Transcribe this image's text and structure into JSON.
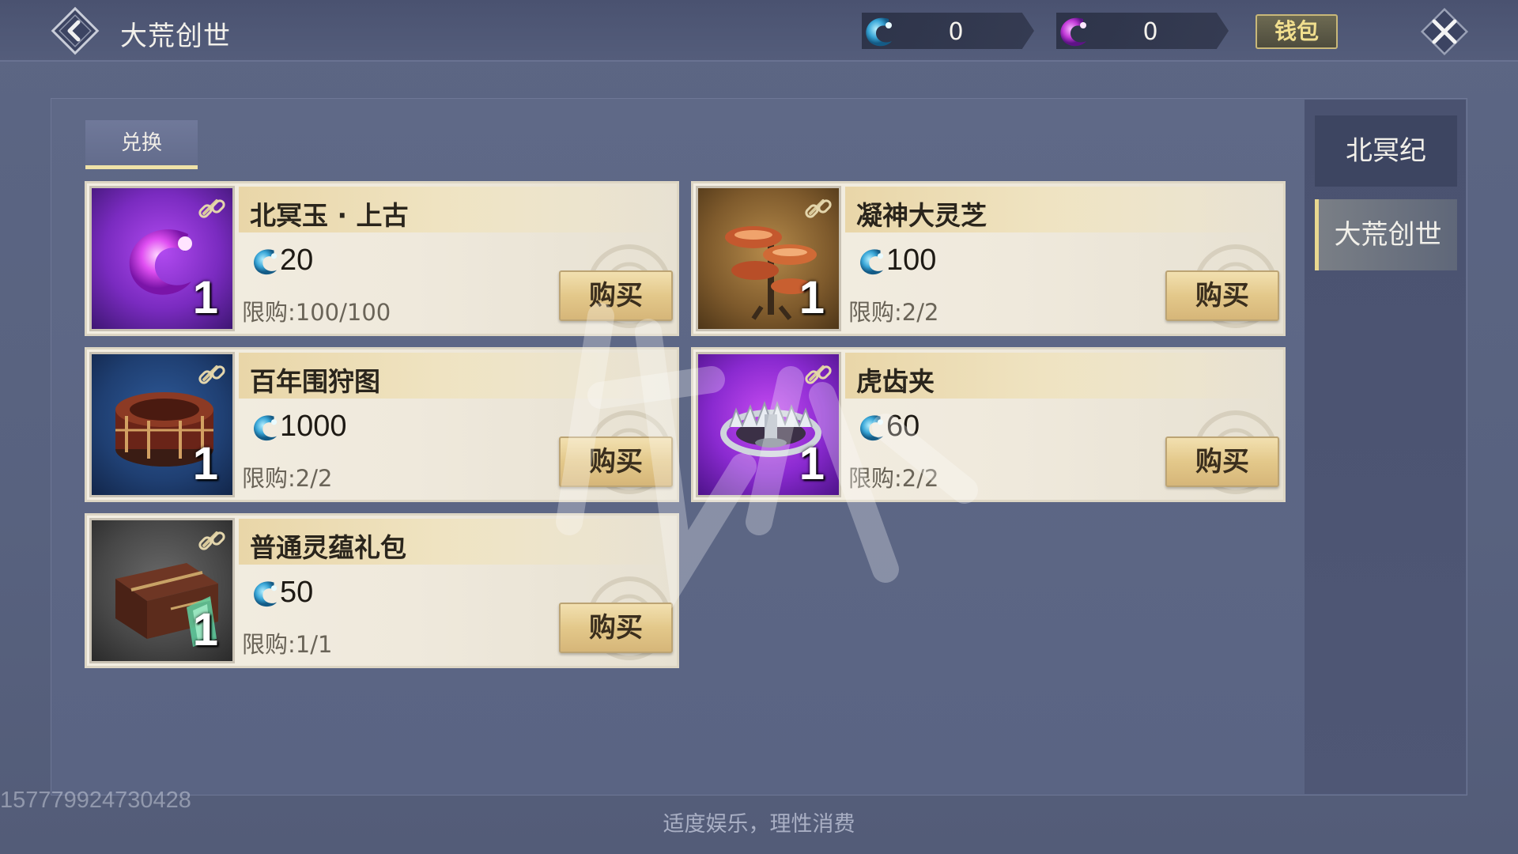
{
  "header": {
    "title": "大荒创世",
    "wallet_label": "钱包",
    "currencies": [
      {
        "icon": "blue-jade-currency-icon",
        "value": "0"
      },
      {
        "icon": "purple-jade-currency-icon",
        "value": "0"
      }
    ]
  },
  "tabs": [
    {
      "label": "兑换"
    }
  ],
  "sidebar": {
    "items": [
      {
        "label": "北冥纪",
        "active": false
      },
      {
        "label": "大荒创世",
        "active": true
      }
    ]
  },
  "items": [
    {
      "name": "北冥玉 · 上古",
      "price": "20",
      "limit": "限购:100/100",
      "qty": "1",
      "buy_label": "购买",
      "icon": "purple-jade-item-icon"
    },
    {
      "name": "凝神大灵芝",
      "price": "100",
      "limit": "限购:2/2",
      "qty": "1",
      "buy_label": "购买",
      "icon": "lingzhi-mushroom-icon"
    },
    {
      "name": "百年围狩图",
      "price": "1000",
      "limit": "限购:2/2",
      "qty": "1",
      "buy_label": "购买",
      "icon": "hunting-scroll-case-icon"
    },
    {
      "name": "虎齿夹",
      "price": "60",
      "limit": "限购:2/2",
      "qty": "1",
      "buy_label": "购买",
      "icon": "bear-trap-icon"
    },
    {
      "name": "普通灵蕴礼包",
      "price": "50",
      "limit": "限购:1/1",
      "qty": "1",
      "buy_label": "购买",
      "icon": "gift-chest-icon"
    }
  ],
  "footer": {
    "note": "适度娱乐，理性消费",
    "uid": "157779924730428"
  },
  "colors": {
    "accent_gold": "#e9d890",
    "panel_bg": "#5a6483",
    "card_bg": "#f3eee2"
  }
}
